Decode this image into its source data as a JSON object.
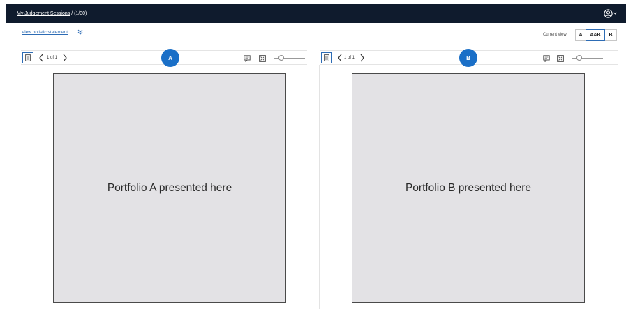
{
  "header": {
    "breadcrumb_link": "My Judgement Sessions",
    "breadcrumb_rest": " / (1/30)",
    "user_icon": "user-circle-icon"
  },
  "subheader": {
    "holistic_link": "View holistic statement",
    "current_view_label": "Current view",
    "views": [
      {
        "label": "A",
        "selected": false
      },
      {
        "label": "A&B",
        "selected": true
      },
      {
        "label": "B",
        "selected": false
      }
    ]
  },
  "panels": [
    {
      "badge": "A",
      "pager": "1 of 1",
      "portfolio_text": "Portfolio A presented here"
    },
    {
      "badge": "B",
      "pager": "1 of 1",
      "portfolio_text": "Portfolio B presented here"
    }
  ],
  "colors": {
    "topbar": "#0f1b2d",
    "accent": "#1a6fc7",
    "link": "#2d6cb5",
    "portfolio_bg": "#e3e2e5"
  }
}
